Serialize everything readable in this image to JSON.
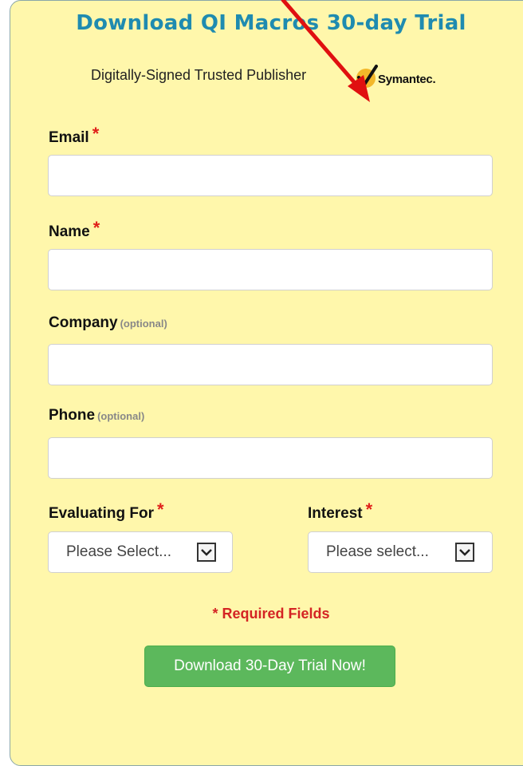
{
  "header": {
    "title": "Download QI Macros 30-day Trial",
    "publisher_text": "Digitally-Signed Trusted Publisher",
    "symantec_label": "Symantec."
  },
  "form": {
    "email": {
      "label": "Email",
      "required_mark": "*",
      "value": ""
    },
    "name": {
      "label": "Name",
      "required_mark": "*",
      "value": ""
    },
    "company": {
      "label": "Company",
      "optional_text": "(optional)",
      "value": ""
    },
    "phone": {
      "label": "Phone",
      "optional_text": "(optional)",
      "value": ""
    },
    "evaluating_for": {
      "label": "Evaluating For",
      "required_mark": "*",
      "selected": "Please Select..."
    },
    "interest": {
      "label": "Interest",
      "required_mark": "*",
      "selected": "Please select..."
    }
  },
  "required_note": "* Required Fields",
  "download_button": "Download 30-Day Trial Now!",
  "colors": {
    "panel_bg": "#fff7ab",
    "title": "#1f8bb0",
    "required": "#e0201a",
    "button": "#5cb85c",
    "annotation_arrow": "#e01010"
  }
}
